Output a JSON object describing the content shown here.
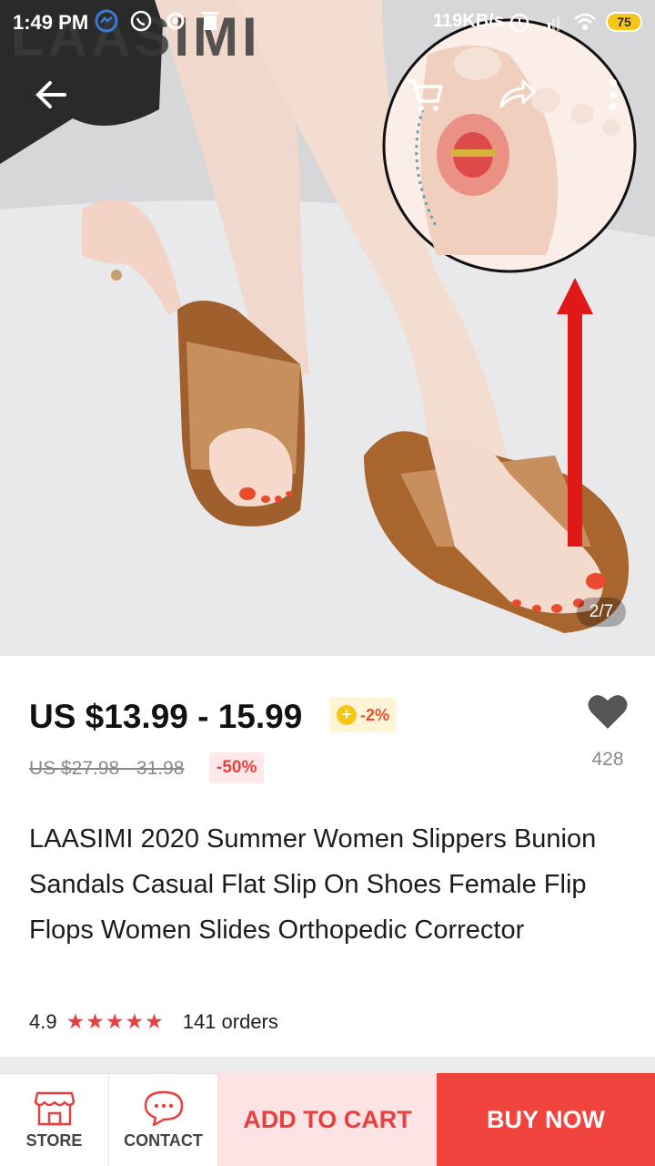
{
  "status_bar": {
    "time": "1:49 PM",
    "net_speed": "119KB/s",
    "battery": "75"
  },
  "brand_watermark": "LAASIMI",
  "hero": {
    "page_indicator": "2/7"
  },
  "product": {
    "price": "US $13.99 - 15.99",
    "coin_discount": "-2%",
    "original_price": "US $27.98 - 31.98",
    "discount": "-50%",
    "wishlist_count": "428",
    "title": "LAASIMI 2020 Summer Women Slippers Bunion Sandals Casual Flat Slip On Shoes Female Flip Flops Women Slides Orthopedic Corrector",
    "rating": "4.9",
    "stars": "★★★★★",
    "orders": "141 orders"
  },
  "bottom_bar": {
    "store_label": "STORE",
    "contact_label": "CONTACT",
    "add_to_cart": "ADD TO CART",
    "buy_now": "BUY NOW"
  },
  "colors": {
    "accent_red": "#e8403f",
    "buy_now_bg": "#f2443f",
    "add_to_cart_bg": "#fde3e3"
  }
}
